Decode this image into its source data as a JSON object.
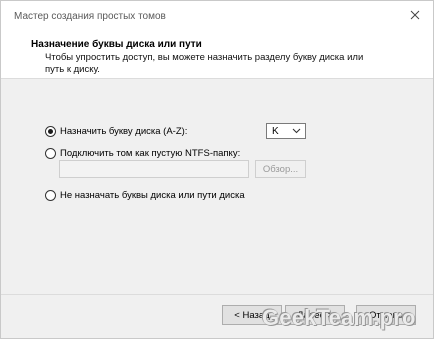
{
  "window": {
    "title": "Мастер создания простых томов",
    "close_icon": "close-icon"
  },
  "header": {
    "title": "Назначение буквы диска или пути",
    "subtitle": "Чтобы упростить доступ, вы можете назначить разделу букву диска или путь к диску."
  },
  "options": {
    "assign_letter": {
      "label": "Назначить букву диска (A-Z):",
      "checked": true
    },
    "mount_folder": {
      "label": "Подключить том как пустую NTFS-папку:",
      "checked": false
    },
    "no_letter": {
      "label": "Не назначать буквы диска или пути диска",
      "checked": false
    }
  },
  "drive_letter": {
    "value": "K"
  },
  "folder_path": {
    "value": ""
  },
  "browse_label": "Обзор...",
  "buttons": {
    "back": "< Назад",
    "next": "Далее >",
    "cancel": "Отмена"
  },
  "watermark": "GeekTeam.pro"
}
